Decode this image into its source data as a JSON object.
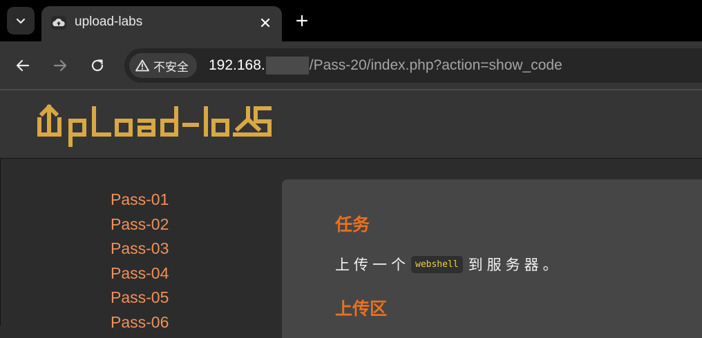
{
  "browser": {
    "tab": {
      "title": "upload-labs"
    },
    "toolbar": {
      "security_label": "不安全",
      "url_host": "192.168.",
      "url_path": "/Pass-20/index.php?action=show_code"
    }
  },
  "page": {
    "logo_text": "UpLoad-labS",
    "menu": [
      {
        "label": "Pass-01"
      },
      {
        "label": "Pass-02"
      },
      {
        "label": "Pass-03"
      },
      {
        "label": "Pass-04"
      },
      {
        "label": "Pass-05"
      },
      {
        "label": "Pass-06"
      }
    ],
    "task": {
      "heading": "任务",
      "desc_before": "上传一个",
      "code": "webshell",
      "desc_after": "到服务器。"
    },
    "upload": {
      "heading": "上传区"
    }
  },
  "colors": {
    "accent_orange": "#e8711f",
    "menu_link": "#f0915a",
    "logo_gold": "#d8a844",
    "code_yellow": "#e8d44d"
  }
}
